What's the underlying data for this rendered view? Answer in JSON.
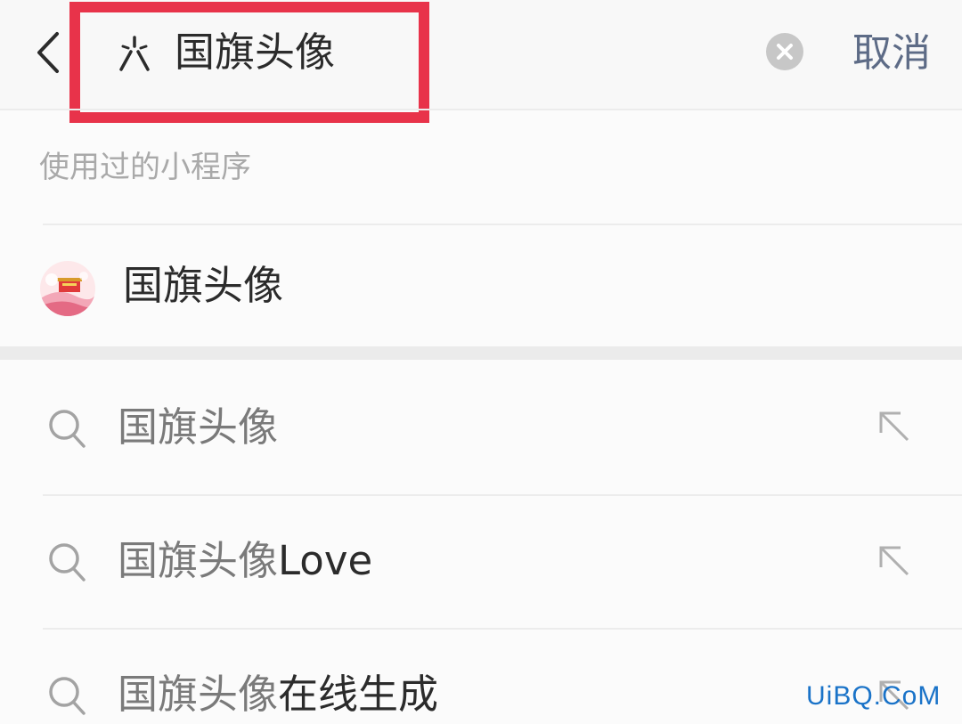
{
  "header": {
    "query": "国旗头像",
    "cancel_label": "取消"
  },
  "used_section": {
    "title": "使用过的小程序",
    "app_name": "国旗头像"
  },
  "suggestions": [
    {
      "query": "国旗头像",
      "suffix": ""
    },
    {
      "query": "国旗头像",
      "suffix": "Love"
    },
    {
      "query": "国旗头像",
      "suffix": "在线生成"
    }
  ],
  "watermark": "UiBQ.CoM",
  "colors": {
    "highlight_box": "#e8334a",
    "cancel_text": "#5d6b86",
    "watermark": "#1a73c8"
  },
  "icons": [
    "back-arrow-icon",
    "mini-program-icon",
    "clear-icon",
    "search-icon",
    "fill-query-arrow-icon"
  ]
}
